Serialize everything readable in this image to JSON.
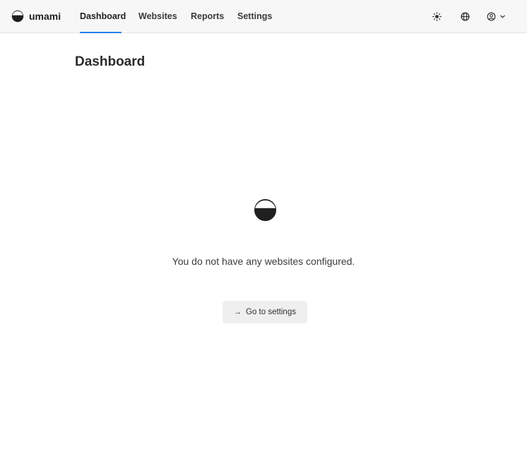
{
  "app": {
    "name": "umami"
  },
  "nav": {
    "links": [
      {
        "label": "Dashboard",
        "active": true
      },
      {
        "label": "Websites",
        "active": false
      },
      {
        "label": "Reports",
        "active": false
      },
      {
        "label": "Settings",
        "active": false
      }
    ],
    "icons": [
      "sun-icon",
      "globe-icon",
      "user-icon",
      "chevron-down-icon"
    ]
  },
  "page": {
    "title": "Dashboard"
  },
  "empty_state": {
    "icon": "umami-logo-icon",
    "message": "You do not have any websites configured.",
    "button_label": "Go to settings",
    "button_icon": "arrow-right-icon"
  },
  "colors": {
    "accent": "#2680eb",
    "nav_bg": "#f7f7f7",
    "button_bg": "#efefef",
    "text": "#2e2e2e"
  }
}
